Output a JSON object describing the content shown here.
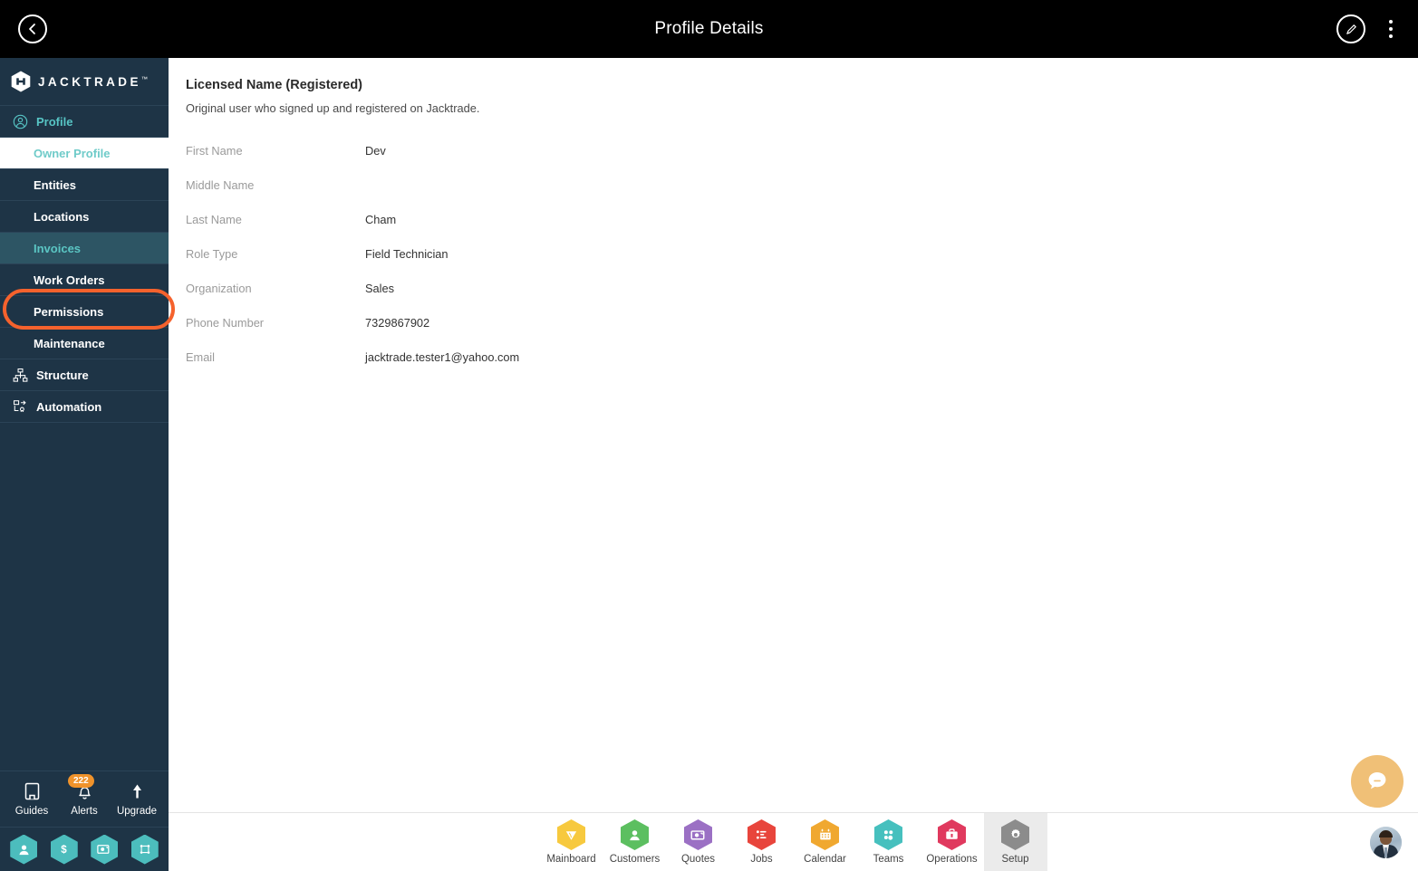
{
  "topbar": {
    "title": "Profile Details",
    "back_icon": "chevron-left-icon",
    "edit_icon": "pencil-icon",
    "menu_icon": "kebab-menu-icon"
  },
  "sidebar": {
    "logo": {
      "text": "JACKTRADE",
      "tm": "™",
      "mark": "jacktrade-hex-logo"
    },
    "nav": [
      {
        "label": "Profile",
        "icon": "user-circle-icon",
        "type": "section",
        "state": "teal"
      },
      {
        "label": "Owner Profile",
        "icon": "",
        "type": "sub",
        "state": "active"
      },
      {
        "label": "Entities",
        "icon": "",
        "type": "sub",
        "state": "normal"
      },
      {
        "label": "Locations",
        "icon": "",
        "type": "sub",
        "state": "normal"
      },
      {
        "label": "Invoices",
        "icon": "",
        "type": "sub",
        "state": "highlighted"
      },
      {
        "label": "Work Orders",
        "icon": "",
        "type": "sub",
        "state": "normal"
      },
      {
        "label": "Permissions",
        "icon": "",
        "type": "sub",
        "state": "normal"
      },
      {
        "label": "Maintenance",
        "icon": "",
        "type": "sub",
        "state": "normal"
      },
      {
        "label": "Structure",
        "icon": "structure-icon",
        "type": "section",
        "state": "normal"
      },
      {
        "label": "Automation",
        "icon": "automation-icon",
        "type": "section",
        "state": "normal"
      }
    ],
    "utilities": [
      {
        "label": "Guides",
        "icon": "book-icon",
        "badge": ""
      },
      {
        "label": "Alerts",
        "icon": "bell-icon",
        "badge": "222"
      },
      {
        "label": "Upgrade",
        "icon": "arrow-up-icon",
        "badge": ""
      }
    ],
    "quick_hexes": [
      {
        "name": "person-hex-icon"
      },
      {
        "name": "dollar-hex-icon"
      },
      {
        "name": "payment-card-hex-icon"
      },
      {
        "name": "workflow-hex-icon"
      }
    ],
    "highlight_color": "#f5622d",
    "background_color": "#1e3446",
    "accent_color": "#57c5c5"
  },
  "main": {
    "section_title": "Licensed Name (Registered)",
    "section_desc": "Original user who signed up and registered on Jacktrade.",
    "fields": [
      {
        "label": "First Name",
        "value": "Dev"
      },
      {
        "label": "Middle Name",
        "value": ""
      },
      {
        "label": "Last Name",
        "value": "Cham"
      },
      {
        "label": "Role Type",
        "value": "Field Technician"
      },
      {
        "label": "Organization",
        "value": "Sales"
      },
      {
        "label": "Phone Number",
        "value": "7329867902"
      },
      {
        "label": "Email",
        "value": "jacktrade.tester1@yahoo.com"
      }
    ]
  },
  "chat": {
    "icon": "chat-bubble-icon",
    "color": "#f0c077"
  },
  "footer": {
    "items": [
      {
        "label": "Mainboard",
        "icon": "mainboard-icon",
        "color": "#F7C93E",
        "active": false
      },
      {
        "label": "Customers",
        "icon": "customers-icon",
        "color": "#5CBF60",
        "active": false
      },
      {
        "label": "Quotes",
        "icon": "quotes-icon",
        "color": "#9B70C4",
        "active": false
      },
      {
        "label": "Jobs",
        "icon": "jobs-icon",
        "color": "#E8453C",
        "active": false
      },
      {
        "label": "Calendar",
        "icon": "calendar-icon",
        "color": "#F0A830",
        "active": false
      },
      {
        "label": "Teams",
        "icon": "teams-icon",
        "color": "#46C0BE",
        "active": false
      },
      {
        "label": "Operations",
        "icon": "operations-icon",
        "color": "#E0395E",
        "active": false
      },
      {
        "label": "Setup",
        "icon": "setup-gear-icon",
        "color": "#8C8C8C",
        "active": true
      }
    ],
    "avatar": "user-avatar"
  }
}
